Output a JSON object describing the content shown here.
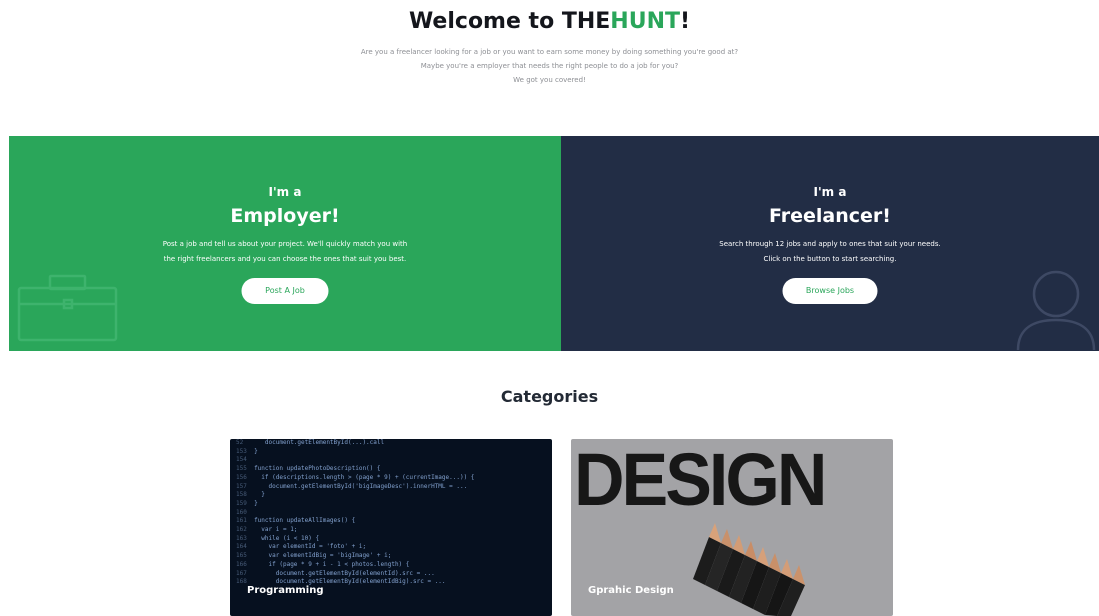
{
  "hero": {
    "title_prefix": "Welcome to THE",
    "title_brand": "HUNT",
    "title_suffix": "!",
    "intro_lines": [
      "Are you a freelancer looking for a job or you want to earn some money by doing something you're good at?",
      "Maybe you're a employer that needs the right people to do a job for you?",
      "We got you covered!"
    ]
  },
  "employer": {
    "pre": "I'm a",
    "role": "Employer!",
    "desc_lines": [
      "Post a job and tell us about your project. We'll quickly match you with",
      "the right freelancers and you can choose the ones that suit you best."
    ],
    "button": "Post A Job",
    "icon": "briefcase-icon"
  },
  "freelancer": {
    "pre": "I'm a",
    "role": "Freelancer!",
    "desc_lines": [
      "Search through 12 jobs and apply to ones that suit your needs.",
      "Click on the button to start searching."
    ],
    "button": "Browse Jobs",
    "icon": "user-icon"
  },
  "categories": {
    "title": "Categories",
    "items": [
      {
        "label": "Programming",
        "image": "code-screen"
      },
      {
        "label": "Gprahic Design",
        "image": "design-pencils",
        "image_text": "DESIGN"
      }
    ]
  },
  "colors": {
    "brand_green": "#2aa65a",
    "navy": "#222d45"
  }
}
